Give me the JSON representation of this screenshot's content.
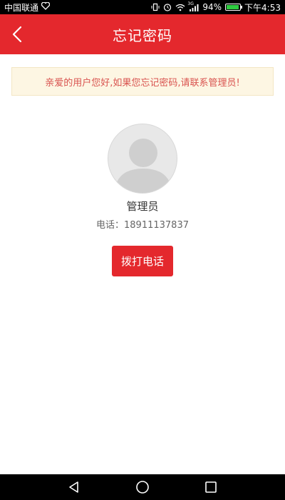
{
  "status_bar": {
    "carrier": "中国联通",
    "battery": "94%",
    "time": "下午4:53",
    "signal_tag": "3G"
  },
  "header": {
    "title": "忘记密码"
  },
  "notice": {
    "text": "亲爱的用户您好,如果您忘记密码,请联系管理员!"
  },
  "contact": {
    "name": "管理员",
    "phone": "电话：18911137837",
    "call_label": "拨打电话"
  },
  "icons": {
    "back": "chevron-left-icon",
    "avatar": "default-user-avatar",
    "nav_back": "triangle-back-icon",
    "nav_home": "circle-home-icon",
    "nav_recent": "square-recent-icon"
  },
  "colors": {
    "brand_red": "#e4282d",
    "notice_bg": "#fdf6e3",
    "notice_text": "#d9534f"
  }
}
